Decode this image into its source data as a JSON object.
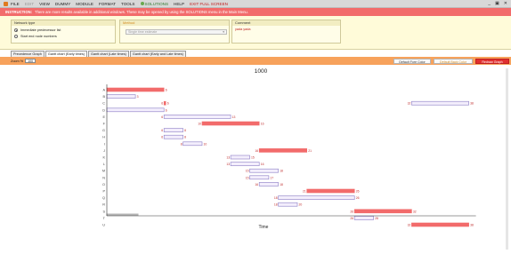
{
  "menu": {
    "items": [
      "FILE",
      "EDIT",
      "VIEW",
      "DUMMY",
      "MODULE",
      "FORMAT",
      "TOOLS",
      "SOLUTIONS",
      "HELP",
      "EXIT FULL SCREEN"
    ],
    "window_controls": [
      "_",
      "▣",
      "✕"
    ]
  },
  "instruction": {
    "label": "INSTRUCTION:",
    "text": "There are more results available in additional windows. These may be opened by using the SOLUTIONS menu in the Main Menu."
  },
  "config": {
    "network_type": {
      "title": "Network type",
      "options": [
        {
          "label": "Immediate predecessor list",
          "selected": true
        },
        {
          "label": "Start end node numbers",
          "selected": false
        }
      ]
    },
    "method": {
      "title": "Method",
      "selected": "Single time estimate"
    },
    "comment": {
      "title": "Comment",
      "text": "yada yada"
    }
  },
  "tabs": [
    "Precedence Graph",
    "Gantt chart (Early times)",
    "Gantt chart (Late times)",
    "Gantt chart (Early and Late times)"
  ],
  "active_tab": 1,
  "toolbar": {
    "zoom_label": "Zoom %",
    "zoom_value": "100",
    "fore_color_button": "Default Fore Color",
    "back_color_button": "Default Back Color",
    "redraw_button": "Redraw Graph"
  },
  "colors": {
    "critical": "#f26b6b",
    "noncritical": "#f3eefc",
    "noncritical_border": "#8a7bc4",
    "label": "#c03030",
    "toolbar": "#f7a25c",
    "instruction": "#f26b6b"
  },
  "chart_data": {
    "type": "gantt",
    "title": "1000",
    "xlabel": "Time",
    "activities": [
      {
        "name": "A",
        "start": 0,
        "end": 6,
        "critical": true
      },
      {
        "name": "B",
        "start": 0,
        "end": 3,
        "critical": false
      },
      {
        "name": "C",
        "start": 6,
        "end": 6,
        "critical": true
      },
      {
        "name": "D",
        "start": 0,
        "end": 6,
        "critical": false
      },
      {
        "name": "E",
        "start": 6,
        "end": 13,
        "critical": false
      },
      {
        "name": "F",
        "start": 10,
        "end": 16,
        "critical": true
      },
      {
        "name": "G",
        "start": 6,
        "end": 8,
        "critical": false
      },
      {
        "name": "H",
        "start": 6,
        "end": 8,
        "critical": false
      },
      {
        "name": "I",
        "start": 8,
        "end": 10,
        "critical": false
      },
      {
        "name": "J",
        "start": 16,
        "end": 21,
        "critical": true
      },
      {
        "name": "K",
        "start": 13,
        "end": 15,
        "critical": false
      },
      {
        "name": "L",
        "start": 13,
        "end": 16,
        "critical": false
      },
      {
        "name": "M",
        "start": 15,
        "end": 18,
        "critical": false
      },
      {
        "name": "N",
        "start": 15,
        "end": 17,
        "critical": false
      },
      {
        "name": "O",
        "start": 16,
        "end": 18,
        "critical": false
      },
      {
        "name": "P",
        "start": 21,
        "end": 26,
        "critical": true
      },
      {
        "name": "Q",
        "start": 18,
        "end": 26,
        "critical": false
      },
      {
        "name": "R",
        "start": 18,
        "end": 20,
        "critical": false
      },
      {
        "name": "S",
        "start": 26,
        "end": 32,
        "critical": true
      },
      {
        "name": "T",
        "start": 26,
        "end": 28,
        "critical": false
      },
      {
        "name": "U",
        "start": 32,
        "end": 38,
        "critical": true
      }
    ],
    "extra_bars": [
      {
        "row": "C",
        "start": 32,
        "end": 38,
        "critical": false
      }
    ]
  }
}
